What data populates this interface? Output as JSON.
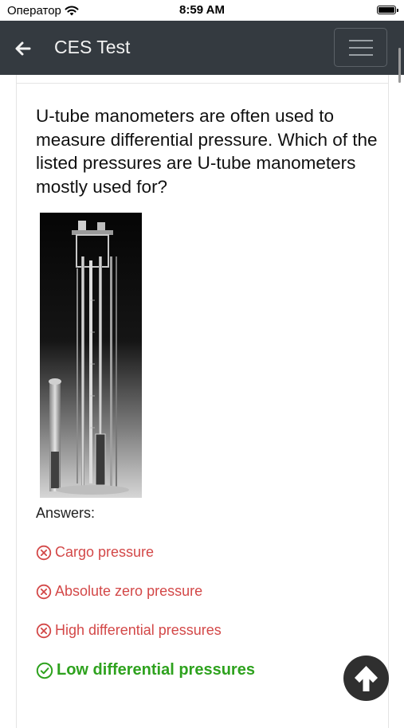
{
  "status_bar": {
    "carrier": "Оператор",
    "time": "8:59 AM"
  },
  "navbar": {
    "title": "CES Test",
    "back_icon": "arrow-left-icon",
    "menu_icon": "hamburger-menu-icon"
  },
  "question": {
    "text": "U-tube manometers are often used to measure differential pressure. Which of the listed pressures are U-tube manometers mostly used for?",
    "image": "u-tube-manometer-photo"
  },
  "answers": {
    "label": "Answers:",
    "items": [
      {
        "text": "Cargo pressure",
        "status": "incorrect",
        "icon": "x-circle-icon"
      },
      {
        "text": "Absolute zero pressure",
        "status": "incorrect",
        "icon": "x-circle-icon"
      },
      {
        "text": "High differential pressures",
        "status": "incorrect",
        "icon": "x-circle-icon"
      },
      {
        "text": "Low differential pressures",
        "status": "correct",
        "icon": "check-circle-icon"
      }
    ]
  },
  "colors": {
    "navbar_bg": "#343a40",
    "incorrect": "#d34848",
    "correct": "#2ea21e",
    "scroll_top_bg": "#2f2f2f"
  },
  "scroll_top_icon": "arrow-up-icon"
}
